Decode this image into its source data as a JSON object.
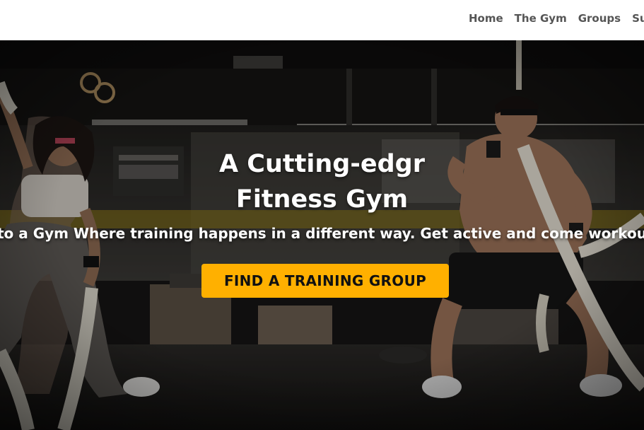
{
  "navbar": {
    "links": [
      {
        "label": "Home"
      },
      {
        "label": "The Gym"
      },
      {
        "label": "Groups"
      },
      {
        "label": "Supp"
      }
    ]
  },
  "hero": {
    "title_line1": "A Cutting-edgr",
    "title_line2": "Fitness Gym",
    "subtitle": "to a Gym Where training happens in a different way. Get active and come workou",
    "cta_label": "FIND A TRAINING GROUP",
    "background": "gym-photo-battle-ropes",
    "colors": {
      "cta_background": "#ffb000",
      "cta_text": "#111111",
      "nav_text": "#555555",
      "hero_text": "#ffffff"
    }
  }
}
